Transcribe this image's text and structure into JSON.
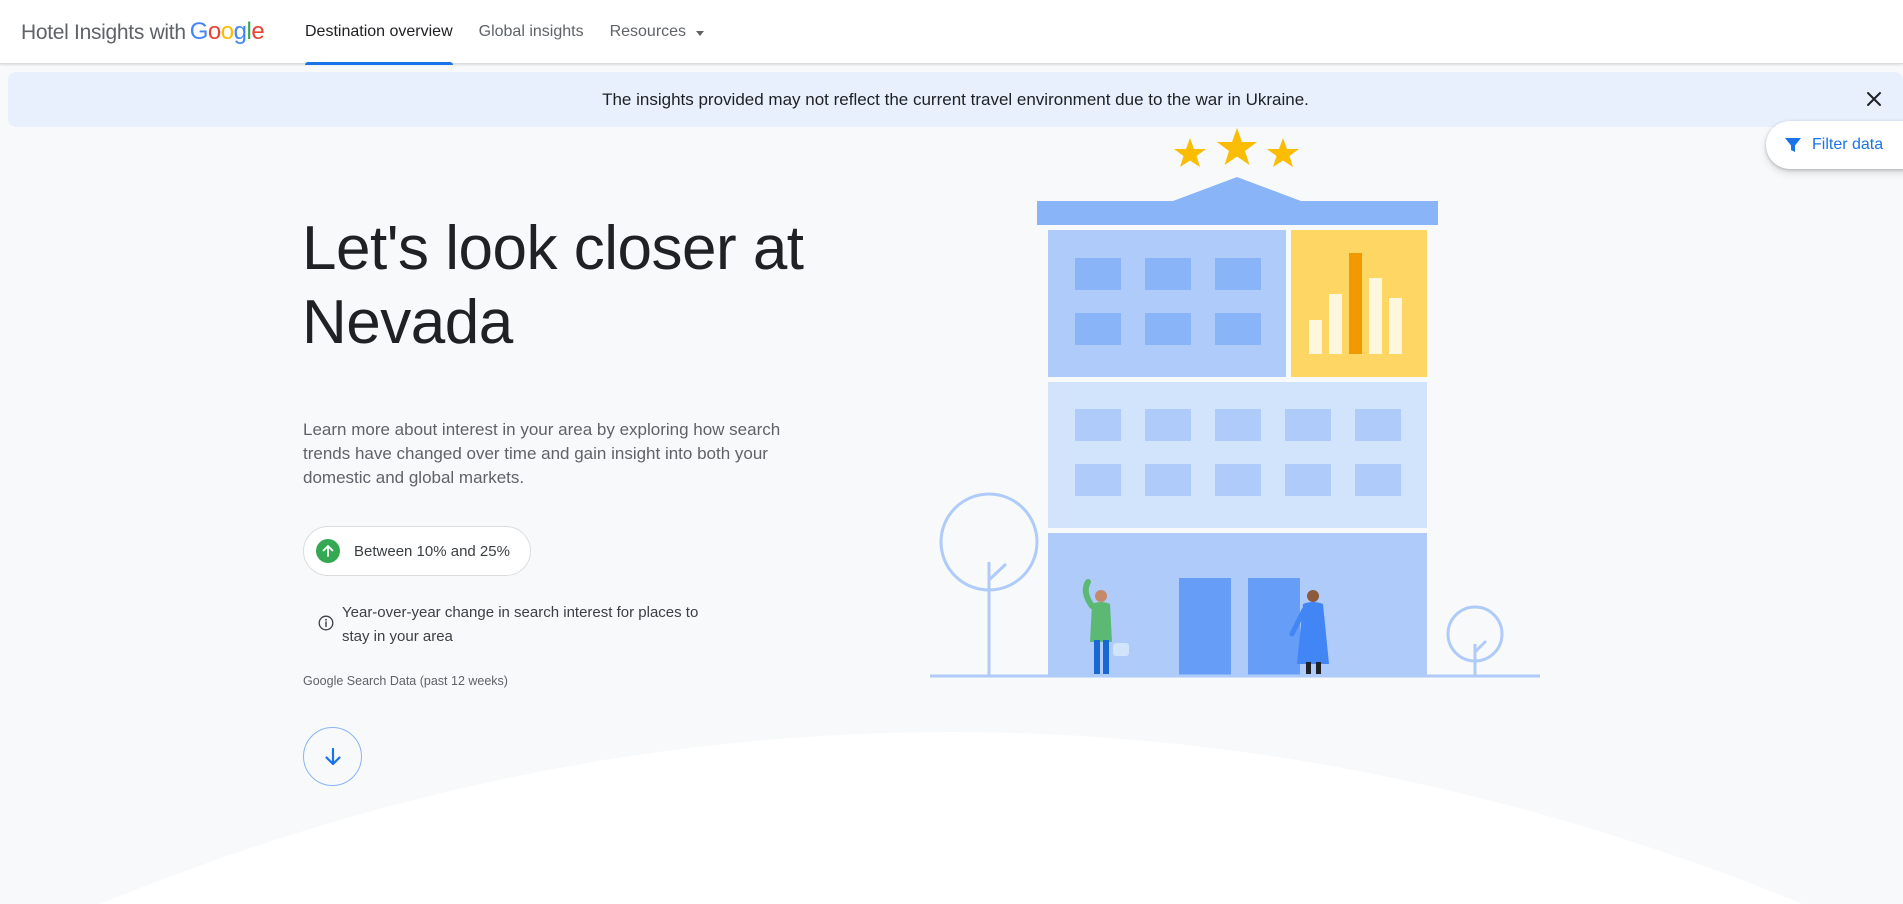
{
  "header": {
    "logo_prefix": "Hotel Insights with",
    "logo_brand": [
      "G",
      "o",
      "o",
      "g",
      "l",
      "e"
    ],
    "tabs": [
      {
        "label": "Destination overview",
        "active": true
      },
      {
        "label": "Global insights",
        "active": false
      },
      {
        "label": "Resources",
        "active": false,
        "has_dropdown": true
      }
    ]
  },
  "banner": {
    "text": "The insights provided may not reflect the current travel environment due to the war in Ukraine.",
    "close_icon": "close-icon"
  },
  "filter": {
    "label": "Filter data",
    "icon": "filter-icon"
  },
  "hero": {
    "title_line1": "Let's look closer at",
    "title_line2": "Nevada",
    "description": "Learn more about interest in your area by exploring how search trends have changed over time and gain insight into both your domestic and global markets.",
    "chip_label": "Between 10% and 25%",
    "chip_icon": "arrow-up-icon",
    "note": "Year-over-year change in search interest for places to stay in your area",
    "note_icon": "info-icon",
    "source": "Google Search Data (past 12 weeks)",
    "scroll_icon": "arrow-down-icon"
  },
  "colors": {
    "accent": "#1a73e8",
    "banner_bg": "#e8f0fe",
    "positive": "#34a853",
    "page_bg": "#f8f9fa"
  }
}
